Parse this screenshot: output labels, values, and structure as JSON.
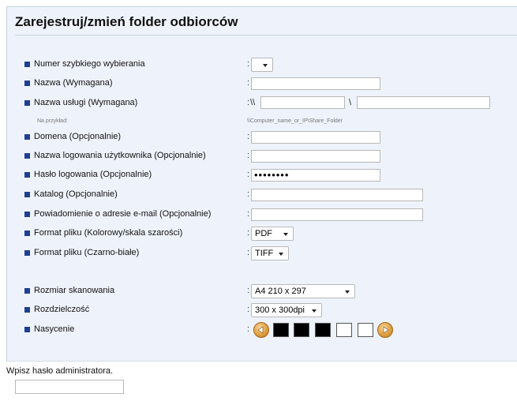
{
  "page": {
    "title": "Zarejestruj/zmień folder odbiorców"
  },
  "fields": {
    "speed_dial": {
      "label": "Numer szybkiego wybierania",
      "value": ""
    },
    "name": {
      "label": "Nazwa (Wymagana)",
      "value": ""
    },
    "service_name": {
      "label": "Nazwa usługi (Wymagana)",
      "prefix": "\\\\",
      "separator": "\\",
      "value1": "",
      "value2": ""
    },
    "service_example": {
      "label": "Na przykład:",
      "value": "\\\\Computer_name_or_IP\\Share_Folder"
    },
    "domain": {
      "label": "Domena (Opcjonalnie)",
      "value": ""
    },
    "login_user": {
      "label": "Nazwa logowania użytkownika (Opcjonalnie)",
      "value": ""
    },
    "login_password": {
      "label": "Hasło logowania (Opcjonalnie)",
      "value": "••••••••"
    },
    "directory": {
      "label": "Katalog (Opcjonalnie)",
      "value": ""
    },
    "email_notification": {
      "label": "Powiadomienie o adresie e-mail (Opcjonalnie)",
      "value": ""
    },
    "file_format_color": {
      "label": "Format pliku (Kolorowy/skala szarości)",
      "value": "PDF"
    },
    "file_format_bw": {
      "label": "Format pliku (Czarno-białe)",
      "value": "TIFF"
    },
    "scan_size": {
      "label": "Rozmiar skanowania",
      "value": "A4 210 x 297"
    },
    "resolution": {
      "label": "Rozdzielczość",
      "value": "300 x 300dpi"
    },
    "density": {
      "label": "Nasycenie",
      "levels_total": 5,
      "selected": 3
    }
  },
  "colon": ":",
  "admin": {
    "label": "Wpisz hasło administratora.",
    "value": ""
  },
  "colors": {
    "panel_bg": "#eef3fb",
    "bullet": "#1f3f8f",
    "swatch_on": "#000000",
    "swatch_off": "#ffffff",
    "arrow": "#e0a040"
  },
  "icons": {
    "decrease": "arrow-left-icon",
    "increase": "arrow-right-icon",
    "dropdown": "caret-down-icon"
  }
}
